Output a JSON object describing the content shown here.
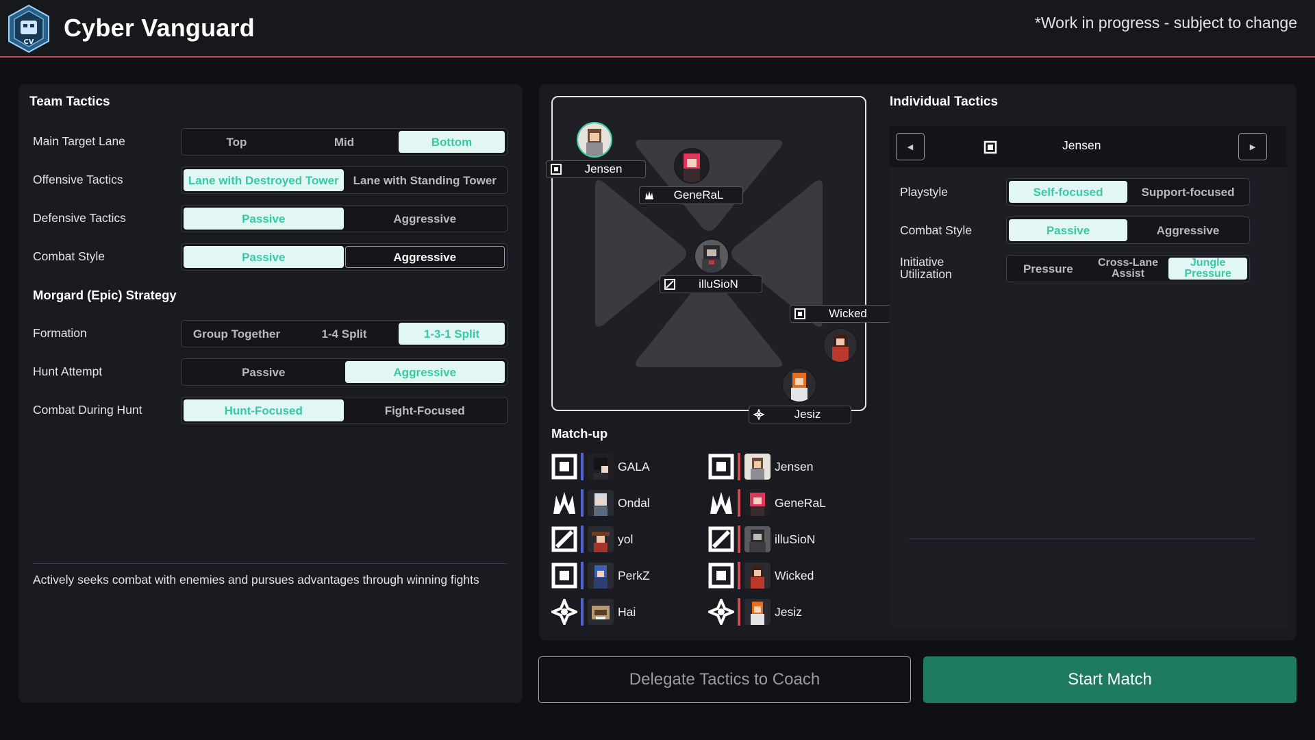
{
  "app": {
    "title": "Cyber Vanguard",
    "notice": "*Work in progress - subject to change"
  },
  "team_tactics": {
    "title": "Team Tactics",
    "rows": [
      {
        "label": "Main Target Lane",
        "options": [
          "Top",
          "Mid",
          "Bottom"
        ],
        "selected": "Bottom"
      },
      {
        "label": "Offensive Tactics",
        "options": [
          "Lane with Destroyed Tower",
          "Lane with Standing Tower"
        ],
        "selected": "Lane with Destroyed Tower"
      },
      {
        "label": "Defensive Tactics",
        "options": [
          "Passive",
          "Aggressive"
        ],
        "selected": "Passive"
      },
      {
        "label": "Combat Style",
        "options": [
          "Passive",
          "Aggressive"
        ],
        "selected": "Passive",
        "hovered": "Aggressive"
      }
    ],
    "epic_title": "Morgard (Epic) Strategy",
    "epic_rows": [
      {
        "label": "Formation",
        "options": [
          "Group Together",
          "1-4 Split",
          "1-3-1 Split"
        ],
        "selected": "1-3-1 Split"
      },
      {
        "label": "Hunt Attempt",
        "options": [
          "Passive",
          "Aggressive"
        ],
        "selected": "Aggressive"
      },
      {
        "label": "Combat During Hunt",
        "options": [
          "Hunt-Focused",
          "Fight-Focused"
        ],
        "selected": "Hunt-Focused"
      }
    ],
    "description": "Actively seeks combat with enemies and pursues advantages through winning fights"
  },
  "map": {
    "players": [
      {
        "name": "Jensen",
        "role_icon": "mid-role-icon"
      },
      {
        "name": "GeneRaL",
        "role_icon": "jungle-role-icon"
      },
      {
        "name": "illuSioN",
        "role_icon": "top-role-icon"
      },
      {
        "name": "Wicked",
        "role_icon": "bottom-role-icon"
      },
      {
        "name": "Jesiz",
        "role_icon": "support-role-icon"
      }
    ]
  },
  "matchup": {
    "title": "Match-up",
    "colors": {
      "blue_side": "#4f63d6",
      "red_side": "#d24a55"
    },
    "rows": [
      {
        "role": "mid-role-icon",
        "blue": "GALA",
        "red": "Jensen"
      },
      {
        "role": "jungle-role-icon",
        "blue": "Ondal",
        "red": "GeneRaL"
      },
      {
        "role": "top-role-icon",
        "blue": "yol",
        "red": "illuSioN"
      },
      {
        "role": "bottom-role-icon",
        "blue": "PerkZ",
        "red": "Wicked"
      },
      {
        "role": "support-role-icon",
        "blue": "Hai",
        "red": "Jesiz"
      }
    ]
  },
  "individual": {
    "title": "Individual Tactics",
    "player": "Jensen",
    "prev_icon": "caret-left-icon",
    "next_icon": "caret-right-icon",
    "rows": [
      {
        "label": "Playstyle",
        "options": [
          "Self-focused",
          "Support-focused"
        ],
        "selected": "Self-focused"
      },
      {
        "label": "Combat Style",
        "options": [
          "Passive",
          "Aggressive"
        ],
        "selected": "Passive"
      },
      {
        "label": "Initiative Utilization",
        "options": [
          "Pressure",
          "Cross-Lane Assist",
          "Jungle Pressure"
        ],
        "selected": "Jungle Pressure"
      }
    ]
  },
  "actions": {
    "delegate": "Delegate Tactics to Coach",
    "start": "Start Match"
  },
  "colors": {
    "accent": "#37c9a6",
    "active_bg": "#e2f7f3",
    "start_button": "#1e7a60",
    "header_line": "#c24b55"
  }
}
